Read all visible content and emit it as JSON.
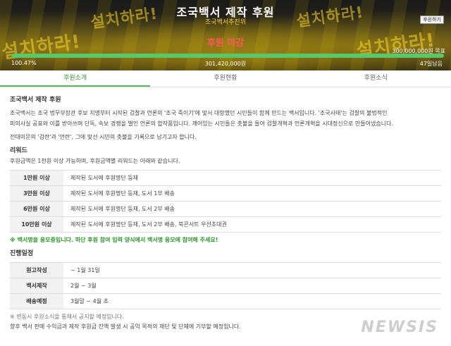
{
  "hero": {
    "title": "조국백서 제작 후원",
    "organizer": "조국백서추진위",
    "share_label": "후원하기",
    "status": "후원 마감",
    "goal": "300,000,000원 목표",
    "progress_percent_label": "100.47%",
    "progress_fraction": 1.0,
    "raised": "301,420,000원",
    "donors": "47일남음",
    "background_sign_text": "설치하라!"
  },
  "tabs": [
    {
      "label": "후원소개",
      "active": true
    },
    {
      "label": "후원현황",
      "active": false
    },
    {
      "label": "후원소식",
      "active": false
    }
  ],
  "intro": {
    "heading": "조국백서 제작 후원",
    "para1": "조국백서는 조국 법무부장관 후보 지명부터 시작된 검찰과 언론의 '조국 죽이기'에 맞서 대항했던 시민들이 함께 만드는 백서입니다. '조국사태'는 검찰의 불법적인",
    "para2": "피의사실 공표와 이를 받아쓰며 단독, 속보 경쟁을 벌인 언론의 합작품입니다. 깨어있는 시민들은 촛불을 들어 검찰개혁과 언론개혁을 시대정신으로 만들어냈습니다.",
    "para3": "전대미문의 '검란'과 '언란', 그에 맞선 시민의 촛불을 기록으로 남기고자 합니다."
  },
  "reward": {
    "heading": "리워드",
    "description": "후원금액은 1천원 이상 가능하며, 후원금액별 리워드는 아래와 같습니다.",
    "rows": [
      {
        "tier": "1만원 이상",
        "detail": "제작된 도서에 후원명단 등재"
      },
      {
        "tier": "3만원 이상",
        "detail": "제작된 도서에 후원명단 등재, 도서 1부 배송"
      },
      {
        "tier": "6만원 이상",
        "detail": "제작된 도서에 후원명단 등재, 도서 2부 배송"
      },
      {
        "tier": "10만원 이상",
        "detail": "제작된 도서에 후원명단 등재, 도서 2부 배송, 북콘서트 우선초대권"
      }
    ],
    "notice": "※ 백서명을 응모중입니다. 하단 후원 참여 입력 양식에서 백서명 응모에 참여해 주세요!"
  },
  "schedule": {
    "heading": "진행일정",
    "rows": [
      {
        "stage": "원고작성",
        "period": "~ 1월 31일"
      },
      {
        "stage": "백서제작",
        "period": "2월 ~ 3월"
      },
      {
        "stage": "배송예정",
        "period": "3월말 ~ 4월 초"
      }
    ],
    "note": "※ 변동시 후원소식을 통해서 공지할 예정입니다.",
    "footer": "향후 백서 판매 수익금과 제작 후원금 잔액 발생 시 공익 목적의 재단 및 단체에 기부할 예정입니다."
  },
  "watermark": "NEWSIS",
  "colors": {
    "accent_green": "#5cb85c",
    "progress_green": "#59c86a",
    "status_red": "#ff5a5a",
    "organizer_yellow": "#ffd23f",
    "notice_green": "#2d9a2d"
  }
}
